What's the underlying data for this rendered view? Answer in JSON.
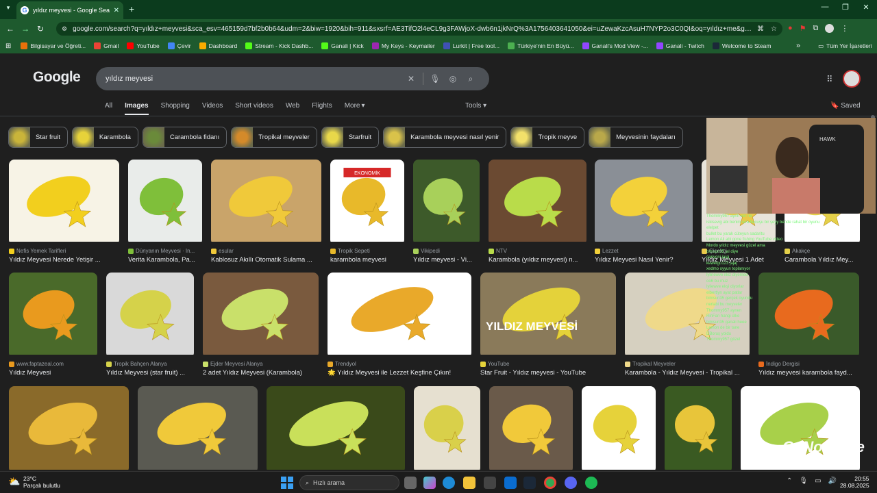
{
  "browser": {
    "tab_title": "yıldız meyvesi - Google Search",
    "url": "google.com/search?q=yıldız+meyvesi&sca_esv=465159d7bf2b0b64&udm=2&biw=1920&bih=911&sxsrf=AE3TifO2l4eCL9g3FAWjoX-dwb6n1jkNrQ%3A1756403641050&ei=uZewaKzcAsuH7NYP2o3C0QI&oq=yıldız+me&gs_lp=EgNpbWc...",
    "bookmarks": [
      {
        "label": "Bilgisayar ve Öğreti...",
        "color": "#e8710a"
      },
      {
        "label": "Gmail",
        "color": "#ea4335"
      },
      {
        "label": "YouTube",
        "color": "#ff0000"
      },
      {
        "label": "Çevir",
        "color": "#4285f4"
      },
      {
        "label": "Dashboard",
        "color": "#f9ab00"
      },
      {
        "label": "Stream - Kick Dashb...",
        "color": "#53fc18"
      },
      {
        "label": "Ganali | Kick",
        "color": "#53fc18"
      },
      {
        "label": "My Keys - Keymailer",
        "color": "#9c27b0"
      },
      {
        "label": "Lurkit | Free tool...",
        "color": "#3f51b5"
      },
      {
        "label": "Türkiye'nin En Büyü...",
        "color": "#4caf50"
      },
      {
        "label": "Ganali's Mod View -...",
        "color": "#9146ff"
      },
      {
        "label": "Ganali - Twitch",
        "color": "#9146ff"
      },
      {
        "label": "Welcome to Steam",
        "color": "#1b2838"
      }
    ],
    "bookmarks_more": "»",
    "all_bookmarks": "Tüm Yer İşaretleri"
  },
  "google": {
    "logo": "Google",
    "query": "yıldız meyvesi",
    "tabs": [
      "All",
      "Images",
      "Shopping",
      "Videos",
      "Short videos",
      "Web",
      "Flights",
      "More"
    ],
    "active_tab": "Images",
    "tools": "Tools",
    "saved": "Saved",
    "chips": [
      {
        "label": "Star fruit",
        "color": "#c9b43a"
      },
      {
        "label": "Karambola",
        "color": "#e6d23a"
      },
      {
        "label": "Carambola fidanı",
        "color": "#6a8a3a"
      },
      {
        "label": "Tropikal meyveler",
        "color": "#d48a2a"
      },
      {
        "label": "Starfruit",
        "color": "#e8d84a"
      },
      {
        "label": "Karambola meyvesi nasıl yenir",
        "color": "#d9c24a"
      },
      {
        "label": "Tropik meyve",
        "color": "#f2e06a"
      },
      {
        "label": "Meyvesinin faydaları",
        "color": "#b9a84a"
      }
    ],
    "results_row1": [
      {
        "source": "Nefis Yemek Tarifleri",
        "caption": "Yıldız Meyvesi Nerede Yetişir ...",
        "bg": "#f7f3e6",
        "fruit": "#f2cf1e"
      },
      {
        "source": "Dünyanın Meyvesi · In...",
        "caption": "Verita Karambola, Pa...",
        "bg": "#e9ecea",
        "fruit": "#7fbf3a"
      },
      {
        "source": "esular",
        "caption": "Kablosuz Akıllı Otomatik Sulama ...",
        "bg": "#c9a46a",
        "fruit": "#f0c93a"
      },
      {
        "source": "Tropik Sepeti",
        "caption": "karambola meyvesi",
        "bg": "#ffffff",
        "fruit": "#e8b92a"
      },
      {
        "source": "Vikipedi",
        "caption": "Yıldız meyvesi - Vi...",
        "bg": "#3d5a2a",
        "fruit": "#a8d05a"
      },
      {
        "source": "NTV",
        "caption": "Karambola (yıldız meyvesi) n...",
        "bg": "#6b4a32",
        "fruit": "#b9dc4a"
      },
      {
        "source": "Lezzet",
        "caption": "Yıldız Meyvesi Nasıl Yenir?",
        "bg": "#8a8f96",
        "fruit": "#f3d13a"
      },
      {
        "source": "Çiçekçi",
        "caption": "Yıldız Meyvesi 1 Adet",
        "bg": "#e8e4da",
        "fruit": "#e9c84a"
      },
      {
        "source": "Akakçe",
        "caption": "Carambola Yıldız Mey...",
        "bg": "#ffffff",
        "fruit": "#e4d04a"
      }
    ],
    "results_row2": [
      {
        "source": "www.faptazeal.com",
        "caption": "Yıldız Meyvesi",
        "bg": "#4a6a2a",
        "fruit": "#e99a1e"
      },
      {
        "source": "Tropik Bahçen Alanya",
        "caption": "Yıldız Meyvesi (star fruit) ...",
        "bg": "#d9d9d9",
        "fruit": "#d5d24a"
      },
      {
        "source": "Ejder Meyvesi Alanya",
        "caption": "2 adet Yıldız Meyvesi (Karambola)",
        "bg": "#7a5a3e",
        "fruit": "#c9e06a"
      },
      {
        "source": "Trendyol",
        "caption": "🌟 Yıldız Meyvesi ile Lezzet Keşfine Çıkın!",
        "bg": "#ffffff",
        "fruit": "#e9a92a"
      },
      {
        "source": "YouTube",
        "caption": "Star Fruit - Yıldız meyvesi - YouTube",
        "bg": "#8a7a5a",
        "fruit": "#e4d23a"
      },
      {
        "source": "Tropikal Meyveler",
        "caption": "Karambola - Yıldız Meyvesi - Tropikal ...",
        "bg": "#d6d0c0",
        "fruit": "#efd98a"
      },
      {
        "source": "İndigo Dergisi",
        "caption": "Yıldız meyvesi karambola fayd...",
        "bg": "#3a5a2a",
        "fruit": "#e86a1e"
      }
    ],
    "youtube_overlay": "YILDIZ MEYVESİ",
    "tropik_badge": "EKONOMİK",
    "results_row3": [
      {
        "bg": "#8a6a2a",
        "fruit": "#e9b93a"
      },
      {
        "bg": "#5a5a52",
        "fruit": "#f0c93a"
      },
      {
        "bg": "#3a4a1a",
        "fruit": "#c9e05a"
      },
      {
        "bg": "#e6e0d0",
        "fruit": "#d9d04a"
      },
      {
        "bg": "#6a5a4a",
        "fruit": "#f1c93a"
      },
      {
        "bg": "#ffffff",
        "fruit": "#e6d23a"
      },
      {
        "bg": "#3a5a22",
        "fruit": "#e8c53a"
      },
      {
        "bg": "#ffffff",
        "fruit": "#a8d04a"
      }
    ]
  },
  "stream_overlay": {
    "watermark": "GaNoGame",
    "chat_lines": [
      "Thommy957 ayrılı ver ne",
      "iskisevig abi benim sıra hecuşu bir şeyy bende rahat bir oyunu",
      "elelpet",
      "bullet bu yarak cüteyun sadaritu",
      "Lemon   Ali abi gone fishing YouTube video",
      "Mordo   yıldız meyvesi güzel ama",
      "bimsun35  jal diye",
      "ganyoni   jajaj",
      "kewetgo123  jajaj",
      "xedmo   oyyun toplanıyor",
      "lylinewve  ilkiz diyemed",
      "oo6 bu muz",
      "lyliewve  ekşi diyorlar",
      "elbertlyn  ayat patlar",
      "bimsun35  gerçek oyundu",
      "nerlabi  bu meyveler",
      "Thommy957  aynen",
      "RinFan  hangi ülke",
      "bimsun35  ganali heee",
      "Lemon  de bir tane",
      "DBoruş  yoldu",
      "Thommy957  güzel"
    ]
  },
  "taskbar": {
    "temperature": "23°C",
    "weather": "Parçalı bulutlu",
    "search_placeholder": "Hızlı arama",
    "time": "20:55",
    "date": "28.08.2025"
  }
}
